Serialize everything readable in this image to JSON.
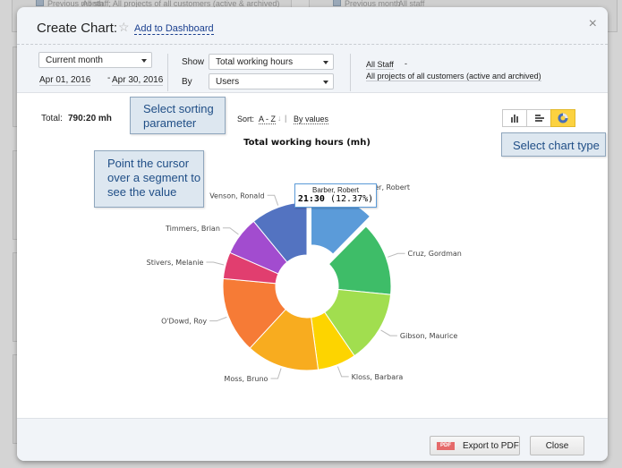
{
  "background": {
    "left_panel_filter": "Previous month",
    "left_panel_scope": "All staff; All projects of all customers (active & archived)",
    "right_panel_filter": "Previous month",
    "right_panel_scope": "All staff"
  },
  "dialog": {
    "title": "Create Chart:",
    "add_to_dashboard": "Add to Dashboard",
    "close_symbol": "×"
  },
  "filters": {
    "period": "Current month",
    "date_from": "Apr 01, 2016",
    "date_separator": "-",
    "date_to": "Apr 30, 2016",
    "show_label": "Show",
    "show_value": "Total working hours",
    "by_label": "By",
    "by_value": "Users",
    "staff_scope": "All Staff",
    "projects_scope": "All projects of all customers (active and archived)",
    "scope_suffix": "-"
  },
  "summary": {
    "total_label": "Total:",
    "total_value": "790:20 mh",
    "sort_label": "Sort:",
    "sort_az": "A - Z",
    "sort_arrow": "↓",
    "sort_sep": "|",
    "sort_values": "By values"
  },
  "chart_types": [
    {
      "name": "column-chart",
      "active": false
    },
    {
      "name": "bar-chart",
      "active": false
    },
    {
      "name": "donut-chart",
      "active": true
    }
  ],
  "callouts": {
    "sorting": "Select sorting parameter",
    "chart_type": "Select chart type",
    "hover": "Point the cursor over a segment to see the value"
  },
  "tooltip": {
    "name": "Barber, Robert",
    "value": "21:30",
    "percent": "(12.37%)"
  },
  "footer": {
    "export_label": "Export to PDF",
    "pdf_badge": "PDF",
    "close_label": "Close"
  },
  "chart_data": {
    "type": "pie",
    "title": "Total working hours (mh)",
    "donut": true,
    "exploded": "Barber, Robert",
    "categories": [
      "Barber, Robert",
      "Cruz, Gordman",
      "Gibson, Maurice",
      "Kloss, Barbara",
      "Moss, Bruno",
      "O'Dowd, Roy",
      "Stivers, Melanie",
      "Timmers, Brian",
      "Venson, Ronald"
    ],
    "values": [
      12.37,
      14.2,
      13.9,
      7.4,
      14.0,
      14.6,
      5.1,
      7.5,
      10.93
    ],
    "value_unit": "percent",
    "colors": [
      "#5b9bd9",
      "#3ebd68",
      "#a1de4f",
      "#fdd400",
      "#f8ac1f",
      "#f67b36",
      "#e13e6f",
      "#a24ccf",
      "#5373c1"
    ]
  }
}
